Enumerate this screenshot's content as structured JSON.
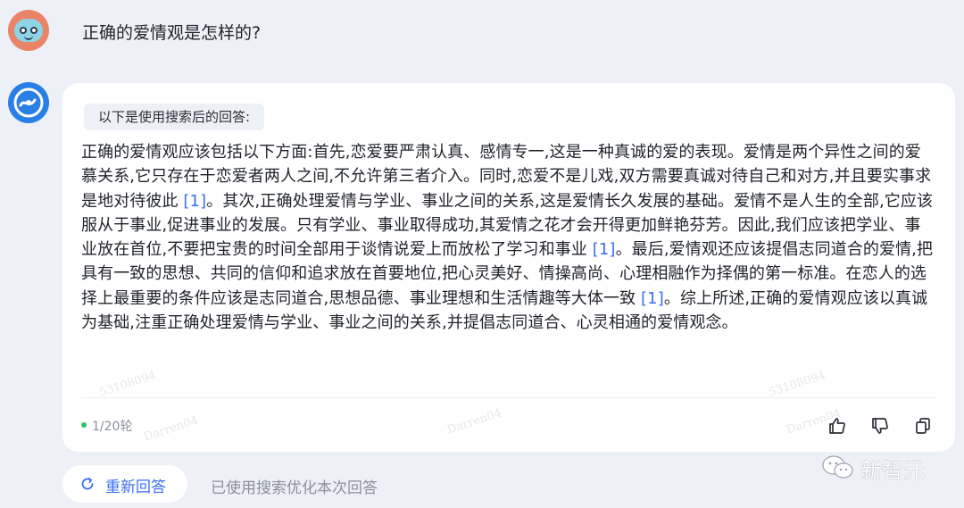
{
  "user": {
    "question": "正确的爱情观是怎样的?"
  },
  "answer": {
    "search_tag": "以下是使用搜索后的回答:",
    "segments": [
      "正确的爱情观应该包括以下方面:首先,恋爱要严肃认真、感情专一,这是一种真诚的爱的表现。爱情是两个异性之间的爱慕关系,它只存在于恋爱者两人之间,不允许第三者介入。同时,恋爱不是儿戏,双方需要真诚对待自己和对方,并且要实事求是地对待彼此 ",
      "。其次,正确处理爱情与学业、事业之间的关系,这是爱情长久发展的基础。爱情不是人生的全部,它应该服从于事业,促进事业的发展。只有学业、事业取得成功,其爱情之花才会开得更加鲜艳芬芳。因此,我们应该把学业、事业放在首位,不要把宝贵的时间全部用于谈情说爱上而放松了学习和事业 ",
      "。最后,爱情观还应该提倡志同道合的爱情,把具有一致的思想、共同的信仰和追求放在首要地位,把心灵美好、情操高尚、心理相融作为择偶的第一标准。在恋人的选择上最重要的条件应该是志同道合,思想品德、事业理想和生活情趣等大体一致 ",
      "。综上所述,正确的爱情观应该以真诚为基础,注重正确处理爱情与学业、事业之间的关系,并提倡志同道合、心灵相通的爱情观念。"
    ],
    "citations": [
      "[1]",
      "[1]",
      "[1]"
    ],
    "round_counter": "1/20轮"
  },
  "watermarks": [
    "53108094",
    "Darren04",
    "Darren04",
    "53108094",
    "Darren04"
  ],
  "footer": {
    "regenerate_label": "重新回答",
    "search_note": "已使用搜索优化本次回答",
    "brand_name": "新智元"
  },
  "colors": {
    "accent": "#3a6ff2",
    "background": "#eef0f8",
    "card": "#ffffff"
  },
  "icons": {
    "regenerate": "refresh-icon",
    "like": "thumbs-up-icon",
    "dislike": "thumbs-down-icon",
    "copy": "copy-icon",
    "brand": "wechat-icon"
  }
}
